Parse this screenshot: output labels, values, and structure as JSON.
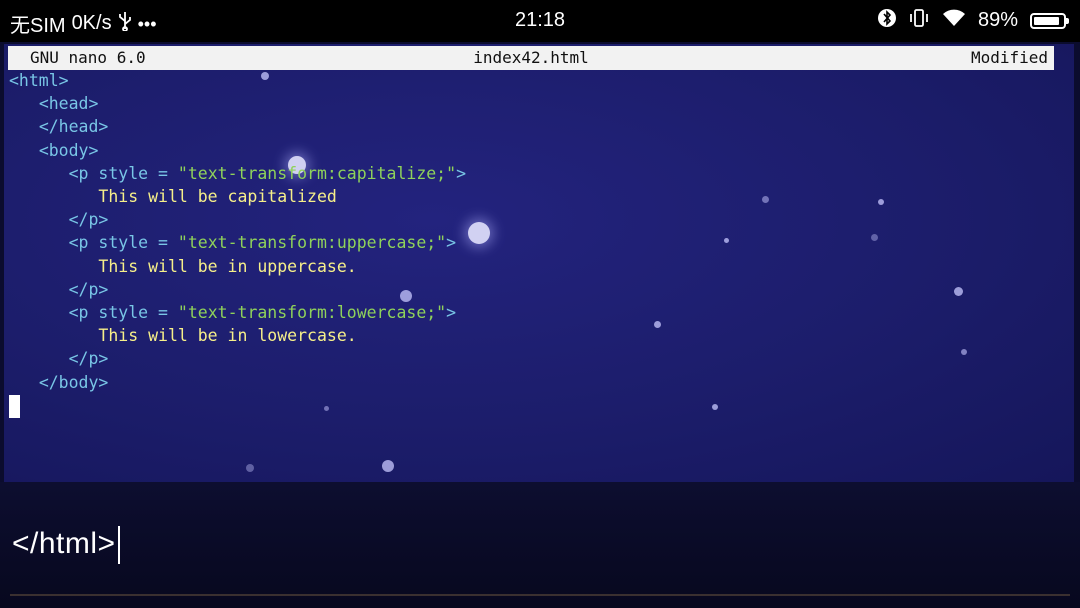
{
  "status_bar": {
    "carrier": "无SIM",
    "network_speed": "0K/s",
    "usb_icon": "usb-icon",
    "more_icon": "more-dots-icon",
    "time": "21:18",
    "bluetooth_icon": "bluetooth-icon",
    "vibrate_icon": "vibrate-icon",
    "wifi_icon": "wifi-icon",
    "battery_percent": "89%",
    "battery_level": 0.89
  },
  "nano": {
    "app_version": "GNU nano 6.0",
    "filename": "index42.html",
    "state": "Modified",
    "lines": [
      {
        "indent": "",
        "parts": [
          {
            "k": "tag",
            "t": "<html>"
          }
        ]
      },
      {
        "indent": "   ",
        "parts": [
          {
            "k": "tag",
            "t": "<head>"
          }
        ]
      },
      {
        "indent": "   ",
        "parts": [
          {
            "k": "tag",
            "t": "</head>"
          }
        ]
      },
      {
        "indent": "   ",
        "parts": [
          {
            "k": "tag",
            "t": "<body>"
          }
        ]
      },
      {
        "indent": "      ",
        "parts": [
          {
            "k": "tag",
            "t": "<p "
          },
          {
            "k": "attr",
            "t": "style = "
          },
          {
            "k": "str",
            "t": "\"text-transform:capitalize;\""
          },
          {
            "k": "tag",
            "t": ">"
          }
        ]
      },
      {
        "indent": "         ",
        "parts": [
          {
            "k": "txt",
            "t": "This will be capitalized"
          }
        ]
      },
      {
        "indent": "      ",
        "parts": [
          {
            "k": "tag",
            "t": "</p>"
          }
        ]
      },
      {
        "indent": "      ",
        "parts": [
          {
            "k": "tag",
            "t": "<p "
          },
          {
            "k": "attr",
            "t": "style = "
          },
          {
            "k": "str",
            "t": "\"text-transform:uppercase;\""
          },
          {
            "k": "tag",
            "t": ">"
          }
        ]
      },
      {
        "indent": "         ",
        "parts": [
          {
            "k": "txt",
            "t": "This will be in uppercase."
          }
        ]
      },
      {
        "indent": "      ",
        "parts": [
          {
            "k": "tag",
            "t": "</p>"
          }
        ]
      },
      {
        "indent": "      ",
        "parts": [
          {
            "k": "tag",
            "t": "<p "
          },
          {
            "k": "attr",
            "t": "style = "
          },
          {
            "k": "str",
            "t": "\"text-transform:lowercase;\""
          },
          {
            "k": "tag",
            "t": ">"
          }
        ]
      },
      {
        "indent": "         ",
        "parts": [
          {
            "k": "txt",
            "t": "This will be in lowercase."
          }
        ]
      },
      {
        "indent": "      ",
        "parts": [
          {
            "k": "tag",
            "t": "</p>"
          }
        ]
      },
      {
        "indent": "   ",
        "parts": [
          {
            "k": "tag",
            "t": "</body>"
          }
        ]
      }
    ]
  },
  "caption": {
    "text": "</html>"
  },
  "colors": {
    "tag": "#79c6e6",
    "string": "#8fd25a",
    "text": "#f6ef8a",
    "background": "#1c1d6b"
  }
}
